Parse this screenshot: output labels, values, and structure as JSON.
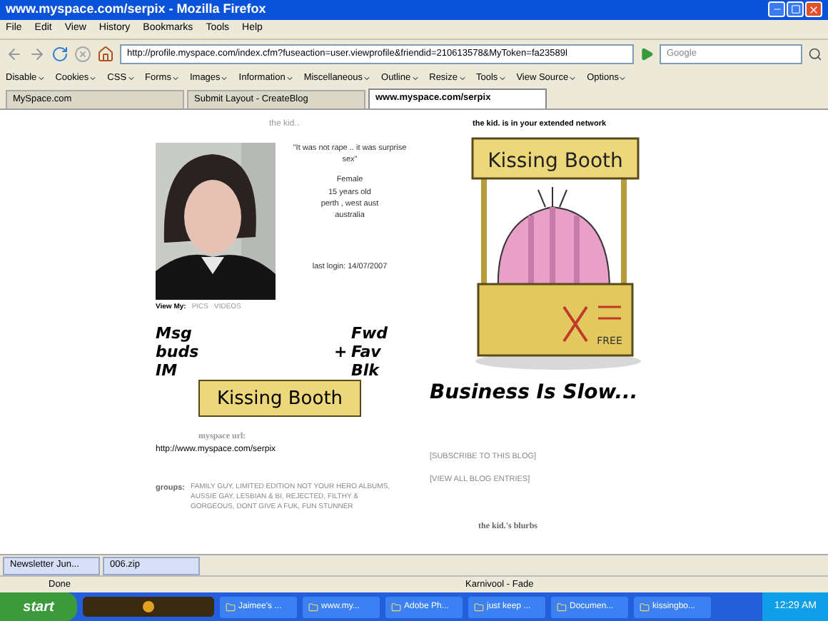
{
  "window": {
    "title": "www.myspace.com/serpix - Mozilla Firefox"
  },
  "menu": [
    "File",
    "Edit",
    "View",
    "History",
    "Bookmarks",
    "Tools",
    "Help"
  ],
  "address": {
    "value": "http://profile.myspace.com/index.cfm?fuseaction=user.viewprofile&friendid=210613578&MyToken=fa23589l"
  },
  "search": {
    "placeholder": "Google"
  },
  "dev_toolbar": [
    "Disable",
    "Cookies",
    "CSS",
    "Forms",
    "Images",
    "Information",
    "Miscellaneous",
    "Outline",
    "Resize",
    "Tools",
    "View Source",
    "Options"
  ],
  "tabs": [
    {
      "label": "MySpace.com",
      "selected": false
    },
    {
      "label": "Submit Layout - CreateBlog",
      "selected": false
    },
    {
      "label": "www.myspace.com/serpix",
      "selected": true
    }
  ],
  "profile": {
    "heading": "the kid..",
    "quote": "\"It was not rape .. it was surprise sex\"",
    "details": [
      "Female",
      "15 years old",
      "perth , west aust",
      "australia"
    ],
    "last_login": "last login:  14/07/2007",
    "view_my_label": "View My:",
    "view_links": [
      "PICS",
      "VIDEOS"
    ]
  },
  "contact": {
    "left": [
      "Msg",
      "buds",
      "IM"
    ],
    "plus": "+",
    "right": [
      "Fwd",
      "Fav",
      "Blk"
    ],
    "sign": "Kissing Booth"
  },
  "network": {
    "text": "the kid. is in your extended network",
    "booth_sign": "Kissing Booth",
    "booth_price": "FREE",
    "caption": "Business Is Slow..."
  },
  "url": {
    "label": "myspace url:",
    "value": "http://www.myspace.com/serpix"
  },
  "blog_links": [
    "[SUBSCRIBE TO THIS BLOG]",
    "[VIEW ALL BLOG ENTRIES]"
  ],
  "groups": {
    "label": "groups:",
    "text": "FAMILY GUY, LIMITED EDITION NOT YOUR HERO ALBUMS, AUSSIE GAY, LESBIAN & BI, REJECTED, FILTHY & GORGEOUS, DONT GIVE A FUK, FUN STUNNER"
  },
  "blurbs": "the kid.'s blurbs",
  "downloads": [
    "Newsletter Jun...",
    "006.zip"
  ],
  "status": {
    "text": "Done",
    "song": "Karnivool - Fade"
  },
  "taskbar": {
    "start": "start",
    "items": [
      "Jaimee's ...",
      "www.my...",
      "Adobe Ph...",
      "just keep ...",
      "Documen...",
      "kissingbo..."
    ],
    "clock": "12:29 AM"
  }
}
